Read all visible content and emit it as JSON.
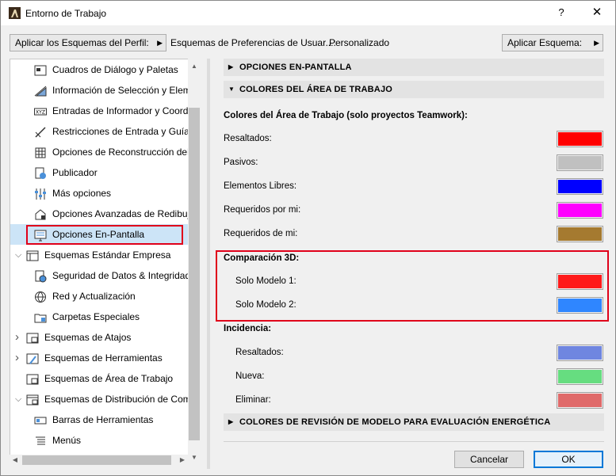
{
  "window": {
    "title": "Entorno de Trabajo",
    "help_label": "?",
    "close_label": "✕"
  },
  "toolbar": {
    "profile_button_label": "Aplicar los Esquemas del Perfil:",
    "breadcrumb": "Esquemas de Preferencias de Usuar...:",
    "breadcrumb_value": "Personalizado",
    "apply_button_label": "Aplicar Esquema:"
  },
  "sidebar": {
    "items": [
      {
        "label": "Cuadros de Diálogo y Paletas",
        "icon": "dialog-palettes-icon",
        "level": 2
      },
      {
        "label": "Información de Selección y Eleme",
        "icon": "selection-info-icon",
        "level": 2
      },
      {
        "label": "Entradas de Informador y Coorde",
        "icon": "xyz-tracker-icon",
        "level": 2
      },
      {
        "label": "Restricciones de Entrada y Guías",
        "icon": "constraints-icon",
        "level": 2
      },
      {
        "label": "Opciones de Reconstrucción del",
        "icon": "rebuild-icon",
        "level": 2
      },
      {
        "label": "Publicador",
        "icon": "publisher-icon",
        "level": 2
      },
      {
        "label": "Más opciones",
        "icon": "more-options-icon",
        "level": 2
      },
      {
        "label": "Opciones Avanzadas de Redibuja",
        "icon": "advanced-redraw-icon",
        "level": 2
      },
      {
        "label": "Opciones En-Pantalla",
        "icon": "on-screen-icon",
        "level": 2,
        "selected": true
      },
      {
        "label": "Esquemas Estándar Empresa",
        "icon": "company-schemes-icon",
        "level": 1,
        "chevron": "expanded"
      },
      {
        "label": "Seguridad de Datos & Integridad",
        "icon": "data-safety-icon",
        "level": 2
      },
      {
        "label": "Red y Actualización",
        "icon": "network-icon",
        "level": 2
      },
      {
        "label": "Carpetas Especiales",
        "icon": "special-folders-icon",
        "level": 2
      },
      {
        "label": "Esquemas de Atajos",
        "icon": "shortcut-schemes-icon",
        "level": 1,
        "chevron": "collapsed"
      },
      {
        "label": "Esquemas de Herramientas",
        "icon": "tool-schemes-icon",
        "level": 1,
        "chevron": "collapsed"
      },
      {
        "label": "Esquemas de Área de Trabajo",
        "icon": "workspace-schemes-icon",
        "level": 1
      },
      {
        "label": "Esquemas de Distribución de Coma",
        "icon": "command-layout-icon",
        "level": 1,
        "chevron": "expanded"
      },
      {
        "label": "Barras de Herramientas",
        "icon": "toolbars-icon",
        "level": 2
      },
      {
        "label": "Menús",
        "icon": "menus-icon",
        "level": 2
      }
    ]
  },
  "panel": {
    "header_onscreen": "OPCIONES EN-PANTALLA",
    "header_workarea": "COLORES DEL ÁREA DE TRABAJO",
    "header_energy": "COLORES DE REVISIÓN DE MODELO PARA EVALUACIÓN ENERGÉTICA",
    "teamwork_title": "Colores del Área de Trabajo (solo proyectos Teamwork):",
    "teamwork_rows": [
      {
        "label": "Resaltados:",
        "color": "#ff0000"
      },
      {
        "label": "Pasivos:",
        "color": "#c0c0c0"
      },
      {
        "label": "Elementos Libres:",
        "color": "#0000ff"
      },
      {
        "label": "Requeridos por mi:",
        "color": "#ff00ff"
      },
      {
        "label": "Requeridos de mi:",
        "color": "#a57a30"
      }
    ],
    "compare_title": "Comparación 3D:",
    "compare_rows": [
      {
        "label": "Solo Modelo 1:",
        "color": "#ff1a1a"
      },
      {
        "label": "Solo Modelo 2:",
        "color": "#2f86ff"
      }
    ],
    "incidence_title": "Incidencia:",
    "incidence_rows": [
      {
        "label": "Resaltados:",
        "color": "#6f86e0"
      },
      {
        "label": "Nueva:",
        "color": "#66dd80"
      },
      {
        "label": "Eliminar:",
        "color": "#e06a6a"
      }
    ]
  },
  "footer": {
    "cancel_label": "Cancelar",
    "ok_label": "OK"
  },
  "colors": {
    "selection_highlight": "#cce4f7",
    "annotation_red": "#e0001a",
    "ok_border": "#0078d7"
  }
}
